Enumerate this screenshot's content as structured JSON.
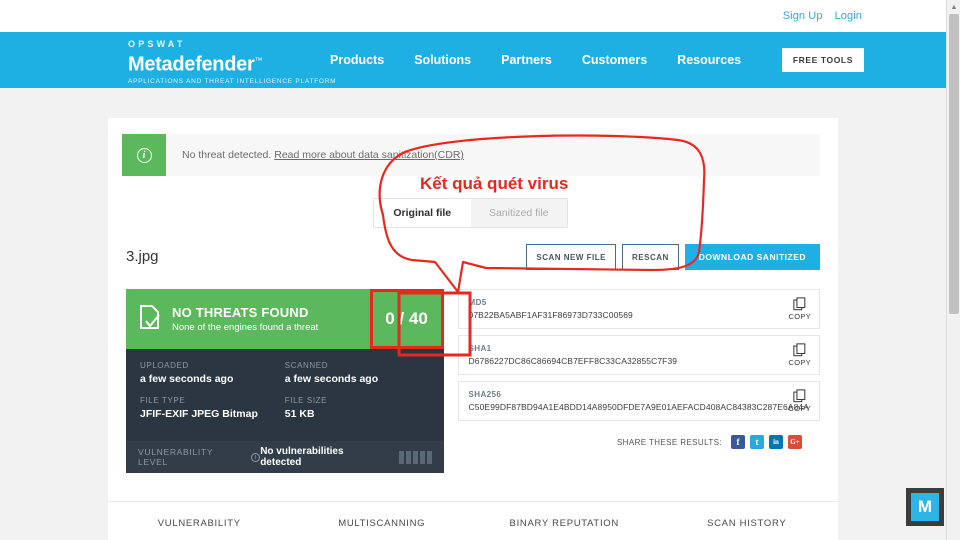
{
  "topbar": {
    "sign_up": "Sign Up",
    "login": "Login"
  },
  "nav": {
    "brand_eyebrow": "OPSWAT",
    "brand_name": "Metadefender",
    "brand_tagline": "APPLICATIONS AND THREAT INTELLIGENCE PLATFORM",
    "links": [
      "Products",
      "Solutions",
      "Partners",
      "Customers",
      "Resources"
    ],
    "cta": "FREE TOOLS",
    "bg_color": "#1fb0e3"
  },
  "banner": {
    "icon": "info-icon",
    "text": "No threat detected.",
    "link": "Read more about data sanitization(CDR)",
    "icon_bg": "#5cb85c"
  },
  "file_tabs": [
    {
      "label": "Original file",
      "active": true
    },
    {
      "label": "Sanitized file",
      "active": false
    }
  ],
  "file": {
    "name": "3.jpg",
    "actions": [
      {
        "label": "SCAN NEW FILE",
        "style": "outline"
      },
      {
        "label": "RESCAN",
        "style": "outline"
      },
      {
        "label": "DOWNLOAD SANITIZED",
        "style": "primary"
      }
    ]
  },
  "verdict": {
    "title": "NO THREATS FOUND",
    "subtitle": "None of the engines found a threat",
    "count": "0 / 40",
    "bg_color": "#5cb85c",
    "highlight_color": "#e8281e"
  },
  "meta": [
    {
      "label": "UPLOADED",
      "value": "a few seconds ago"
    },
    {
      "label": "SCANNED",
      "value": "a few seconds ago"
    },
    {
      "label": "FILE TYPE",
      "value": "JFIF-EXIF JPEG Bitmap"
    },
    {
      "label": "FILE SIZE",
      "value": "51 KB"
    }
  ],
  "vulnerability": {
    "label": "VULNERABILITY LEVEL",
    "info": "i",
    "status": "No vulnerabilities detected",
    "meter_segments": 5
  },
  "hashes": [
    {
      "label": "MD5",
      "value": "07B22BA5ABF1AF31F86973D733C00569",
      "copy": "COPY"
    },
    {
      "label": "SHA1",
      "value": "D6786227DC86C86694CB7EFF8C33CA32855C7F39",
      "copy": "COPY"
    },
    {
      "label": "SHA256",
      "value": "C50E99DF87BD94A1E4BDD14A8950DFDE7A9E01AEFACD408AC84383C287E6A84A",
      "copy": "COPY"
    }
  ],
  "share": {
    "label": "SHARE THESE RESULTS:",
    "networks": [
      {
        "name": "facebook-icon",
        "glyph": "f",
        "color": "#3b5998"
      },
      {
        "name": "twitter-icon",
        "glyph": "t",
        "color": "#29a9e0"
      },
      {
        "name": "linkedin-icon",
        "glyph": "in",
        "color": "#0077b5"
      },
      {
        "name": "googleplus-icon",
        "glyph": "G+",
        "color": "#dd4b39"
      }
    ]
  },
  "bottom_tabs": [
    "VULNERABILITY",
    "MULTISCANNING",
    "BINARY REPUTATION",
    "SCAN HISTORY"
  ],
  "annotation": {
    "text": "Kết quả quét virus",
    "color": "#e8281e"
  },
  "badge": {
    "letter": "M",
    "color": "#2eb5e8"
  }
}
